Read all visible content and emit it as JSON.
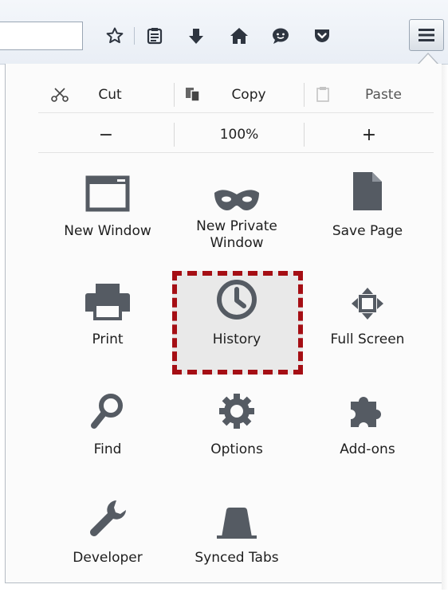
{
  "toolbar": {
    "icons": [
      "bookmark-star-icon",
      "reading-list-icon",
      "downloads-icon",
      "home-icon",
      "hello-icon",
      "pocket-icon",
      "hamburger-menu-icon"
    ]
  },
  "menu": {
    "edit": {
      "cut": "Cut",
      "copy": "Copy",
      "paste": "Paste"
    },
    "zoom": {
      "minus": "−",
      "level": "100%",
      "plus": "+"
    },
    "items": [
      {
        "id": "new-window",
        "label": "New Window",
        "icon": "window-icon"
      },
      {
        "id": "new-private-window",
        "label": "New Private Window",
        "icon": "mask-icon"
      },
      {
        "id": "save-page",
        "label": "Save Page",
        "icon": "page-icon"
      },
      {
        "id": "print",
        "label": "Print",
        "icon": "printer-icon"
      },
      {
        "id": "history",
        "label": "History",
        "icon": "clock-icon",
        "highlighted": true
      },
      {
        "id": "full-screen",
        "label": "Full Screen",
        "icon": "fullscreen-arrows-icon"
      },
      {
        "id": "find",
        "label": "Find",
        "icon": "magnifier-icon"
      },
      {
        "id": "options",
        "label": "Options",
        "icon": "gear-icon"
      },
      {
        "id": "add-ons",
        "label": "Add-ons",
        "icon": "puzzle-piece-icon"
      },
      {
        "id": "developer",
        "label": "Developer",
        "icon": "wrench-icon"
      },
      {
        "id": "synced-tabs",
        "label": "Synced Tabs",
        "icon": "synced-tabs-icon"
      }
    ]
  },
  "colors": {
    "icon": "#555b63",
    "highlight_border": "#a50e14",
    "highlight_bg": "#e9e9e9"
  }
}
